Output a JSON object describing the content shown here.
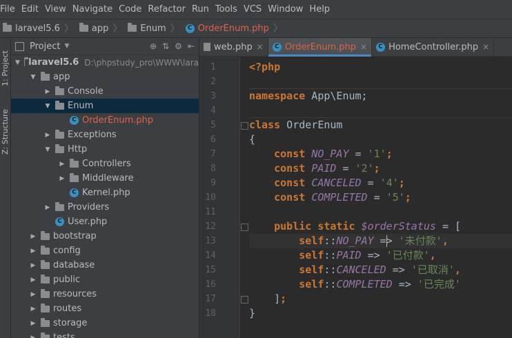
{
  "menu": [
    "File",
    "Edit",
    "View",
    "Navigate",
    "Code",
    "Refactor",
    "Run",
    "Tools",
    "VCS",
    "Window",
    "Help"
  ],
  "breadcrumb": [
    "laravel5.6",
    "app",
    "Enum",
    "OrderEnum.php"
  ],
  "sidebar_tabs": [
    "1: Project",
    "Z: Structure"
  ],
  "project": {
    "title": "Project",
    "root": "laravel5.6",
    "root_path": "D:\\phpstudy_pro\\WWW\\lara",
    "tree": [
      {
        "label": "app",
        "depth": 1,
        "arrow": "▼",
        "kind": "folder"
      },
      {
        "label": "Console",
        "depth": 2,
        "arrow": "▶",
        "kind": "folder"
      },
      {
        "label": "Enum",
        "depth": 2,
        "arrow": "▼",
        "kind": "folder",
        "selected": true
      },
      {
        "label": "OrderEnum.php",
        "depth": 3,
        "arrow": "",
        "kind": "class",
        "red": true
      },
      {
        "label": "Exceptions",
        "depth": 2,
        "arrow": "▶",
        "kind": "folder"
      },
      {
        "label": "Http",
        "depth": 2,
        "arrow": "▼",
        "kind": "folder"
      },
      {
        "label": "Controllers",
        "depth": 3,
        "arrow": "▶",
        "kind": "folder"
      },
      {
        "label": "Middleware",
        "depth": 3,
        "arrow": "▶",
        "kind": "folder"
      },
      {
        "label": "Kernel.php",
        "depth": 3,
        "arrow": "",
        "kind": "class"
      },
      {
        "label": "Providers",
        "depth": 2,
        "arrow": "▶",
        "kind": "folder"
      },
      {
        "label": "User.php",
        "depth": 2,
        "arrow": "",
        "kind": "class"
      },
      {
        "label": "bootstrap",
        "depth": 1,
        "arrow": "▶",
        "kind": "folder"
      },
      {
        "label": "config",
        "depth": 1,
        "arrow": "▶",
        "kind": "folder"
      },
      {
        "label": "database",
        "depth": 1,
        "arrow": "▶",
        "kind": "folder"
      },
      {
        "label": "public",
        "depth": 1,
        "arrow": "▶",
        "kind": "folder"
      },
      {
        "label": "resources",
        "depth": 1,
        "arrow": "▶",
        "kind": "folder"
      },
      {
        "label": "routes",
        "depth": 1,
        "arrow": "▶",
        "kind": "folder"
      },
      {
        "label": "storage",
        "depth": 1,
        "arrow": "▶",
        "kind": "folder"
      },
      {
        "label": "tests",
        "depth": 1,
        "arrow": "▶",
        "kind": "folder"
      }
    ]
  },
  "tabs": [
    {
      "label": "web.php",
      "active": false,
      "icon": "php-file-icon"
    },
    {
      "label": "OrderEnum.php",
      "active": true,
      "icon": "class-icon",
      "red": true
    },
    {
      "label": "HomeController.php",
      "active": false,
      "icon": "class-icon"
    }
  ],
  "code_lines": [
    [
      [
        "kw",
        "<?php"
      ]
    ],
    [],
    [
      [
        "kw",
        "namespace"
      ],
      [
        "t",
        " App\\Enum;"
      ]
    ],
    [],
    [
      [
        "kw",
        "class"
      ],
      [
        "t",
        " OrderEnum"
      ]
    ],
    [
      [
        "t",
        "{"
      ]
    ],
    [
      [
        "t",
        "    "
      ],
      [
        "kw",
        "const"
      ],
      [
        "t",
        " "
      ],
      [
        "cst",
        "NO_PAY"
      ],
      [
        "t",
        " = "
      ],
      [
        "str",
        "'1'"
      ],
      [
        "kw",
        ";"
      ]
    ],
    [
      [
        "t",
        "    "
      ],
      [
        "kw",
        "const"
      ],
      [
        "t",
        " "
      ],
      [
        "cst",
        "PAID"
      ],
      [
        "t",
        " = "
      ],
      [
        "str",
        "'2'"
      ],
      [
        "kw",
        ";"
      ]
    ],
    [
      [
        "t",
        "    "
      ],
      [
        "kw",
        "const"
      ],
      [
        "t",
        " "
      ],
      [
        "cst",
        "CANCELED"
      ],
      [
        "t",
        " = "
      ],
      [
        "str",
        "'4'"
      ],
      [
        "kw",
        ";"
      ]
    ],
    [
      [
        "t",
        "    "
      ],
      [
        "kw",
        "const"
      ],
      [
        "t",
        " "
      ],
      [
        "cst",
        "COMPLETED"
      ],
      [
        "t",
        " = "
      ],
      [
        "str",
        "'5'"
      ],
      [
        "kw",
        ";"
      ]
    ],
    [],
    [
      [
        "t",
        "    "
      ],
      [
        "kw",
        "public static"
      ],
      [
        "t",
        " "
      ],
      [
        "var",
        "$orderStatus"
      ],
      [
        "t",
        " = ["
      ]
    ],
    [
      [
        "t",
        "        "
      ],
      [
        "kw",
        "self"
      ],
      [
        "t",
        "::"
      ],
      [
        "cst",
        "NO_PAY"
      ],
      [
        "t",
        " => "
      ],
      [
        "str",
        "'未付款'"
      ],
      [
        "kw",
        ","
      ]
    ],
    [
      [
        "t",
        "        "
      ],
      [
        "kw",
        "self"
      ],
      [
        "t",
        "::"
      ],
      [
        "cst",
        "PAID"
      ],
      [
        "t",
        " => "
      ],
      [
        "str",
        "'已付款'"
      ],
      [
        "kw",
        ","
      ]
    ],
    [
      [
        "t",
        "        "
      ],
      [
        "kw",
        "self"
      ],
      [
        "t",
        "::"
      ],
      [
        "cst",
        "CANCELED"
      ],
      [
        "t",
        " => "
      ],
      [
        "str",
        "'已取消'"
      ],
      [
        "kw",
        ","
      ]
    ],
    [
      [
        "t",
        "        "
      ],
      [
        "kw",
        "self"
      ],
      [
        "t",
        "::"
      ],
      [
        "cst",
        "COMPLETED"
      ],
      [
        "t",
        " => "
      ],
      [
        "str",
        "'已完成'"
      ]
    ],
    [
      [
        "t",
        "    ]"
      ],
      [
        "kw",
        ";"
      ]
    ],
    [
      [
        "t",
        "}"
      ]
    ]
  ],
  "colors": {
    "keyword": "#cc7832",
    "constant": "#9876aa",
    "string": "#6a8759",
    "text": "#a9b7c6",
    "selection": "#0d293e",
    "accent": "#4a88c7"
  }
}
